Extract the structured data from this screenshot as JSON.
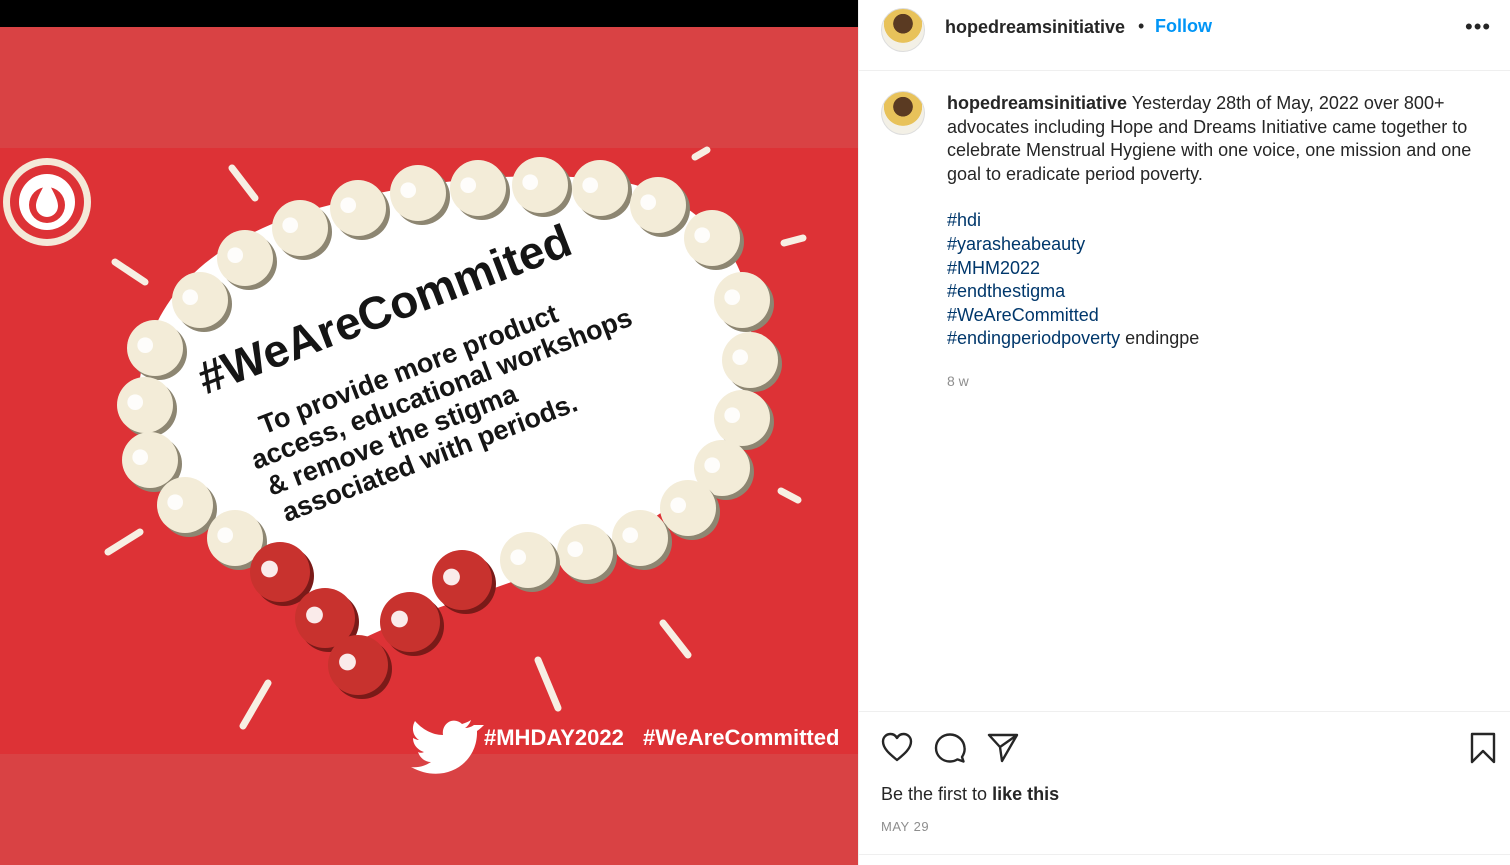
{
  "media": {
    "headline": "#WeAreCommited",
    "body_lines": [
      "To provide more product",
      "access, educational workshops",
      "& remove the stigma",
      "associated with periods."
    ],
    "footer_tags": [
      "#MHDAY2022",
      "#WeAreCommitted"
    ],
    "colors": {
      "red": "#dd3236",
      "pearl": "#f3ecd8",
      "bead_red": "#c8322e"
    }
  },
  "header": {
    "username": "hopedreamsinitiative",
    "separator": "•",
    "follow_label": "Follow",
    "more_label": "•••"
  },
  "caption": {
    "username": "hopedreamsinitiative",
    "text": "Yesterday 28th of May, 2022 over 800+ advocates including Hope and Dreams Initiative came together to celebrate Menstrual Hygiene with one voice, one mission and one goal to eradicate period poverty.",
    "hashtags": [
      "#hdi",
      "#yarasheabeauty",
      "#MHM2022",
      "#endthestigma",
      "#WeAreCommitted",
      "#endingperiodpoverty"
    ],
    "trailing_text": "endingpe",
    "time_ago": "8 w"
  },
  "actions": {
    "icons": [
      "heart-icon",
      "comment-icon",
      "share-icon",
      "bookmark-icon"
    ],
    "likes_prefix": "Be the first to",
    "likes_bold": "like this",
    "date": "MAY 29"
  },
  "colors": {
    "link": "#0095f6",
    "hashtag": "#00376b",
    "muted": "#8e8e8e"
  }
}
